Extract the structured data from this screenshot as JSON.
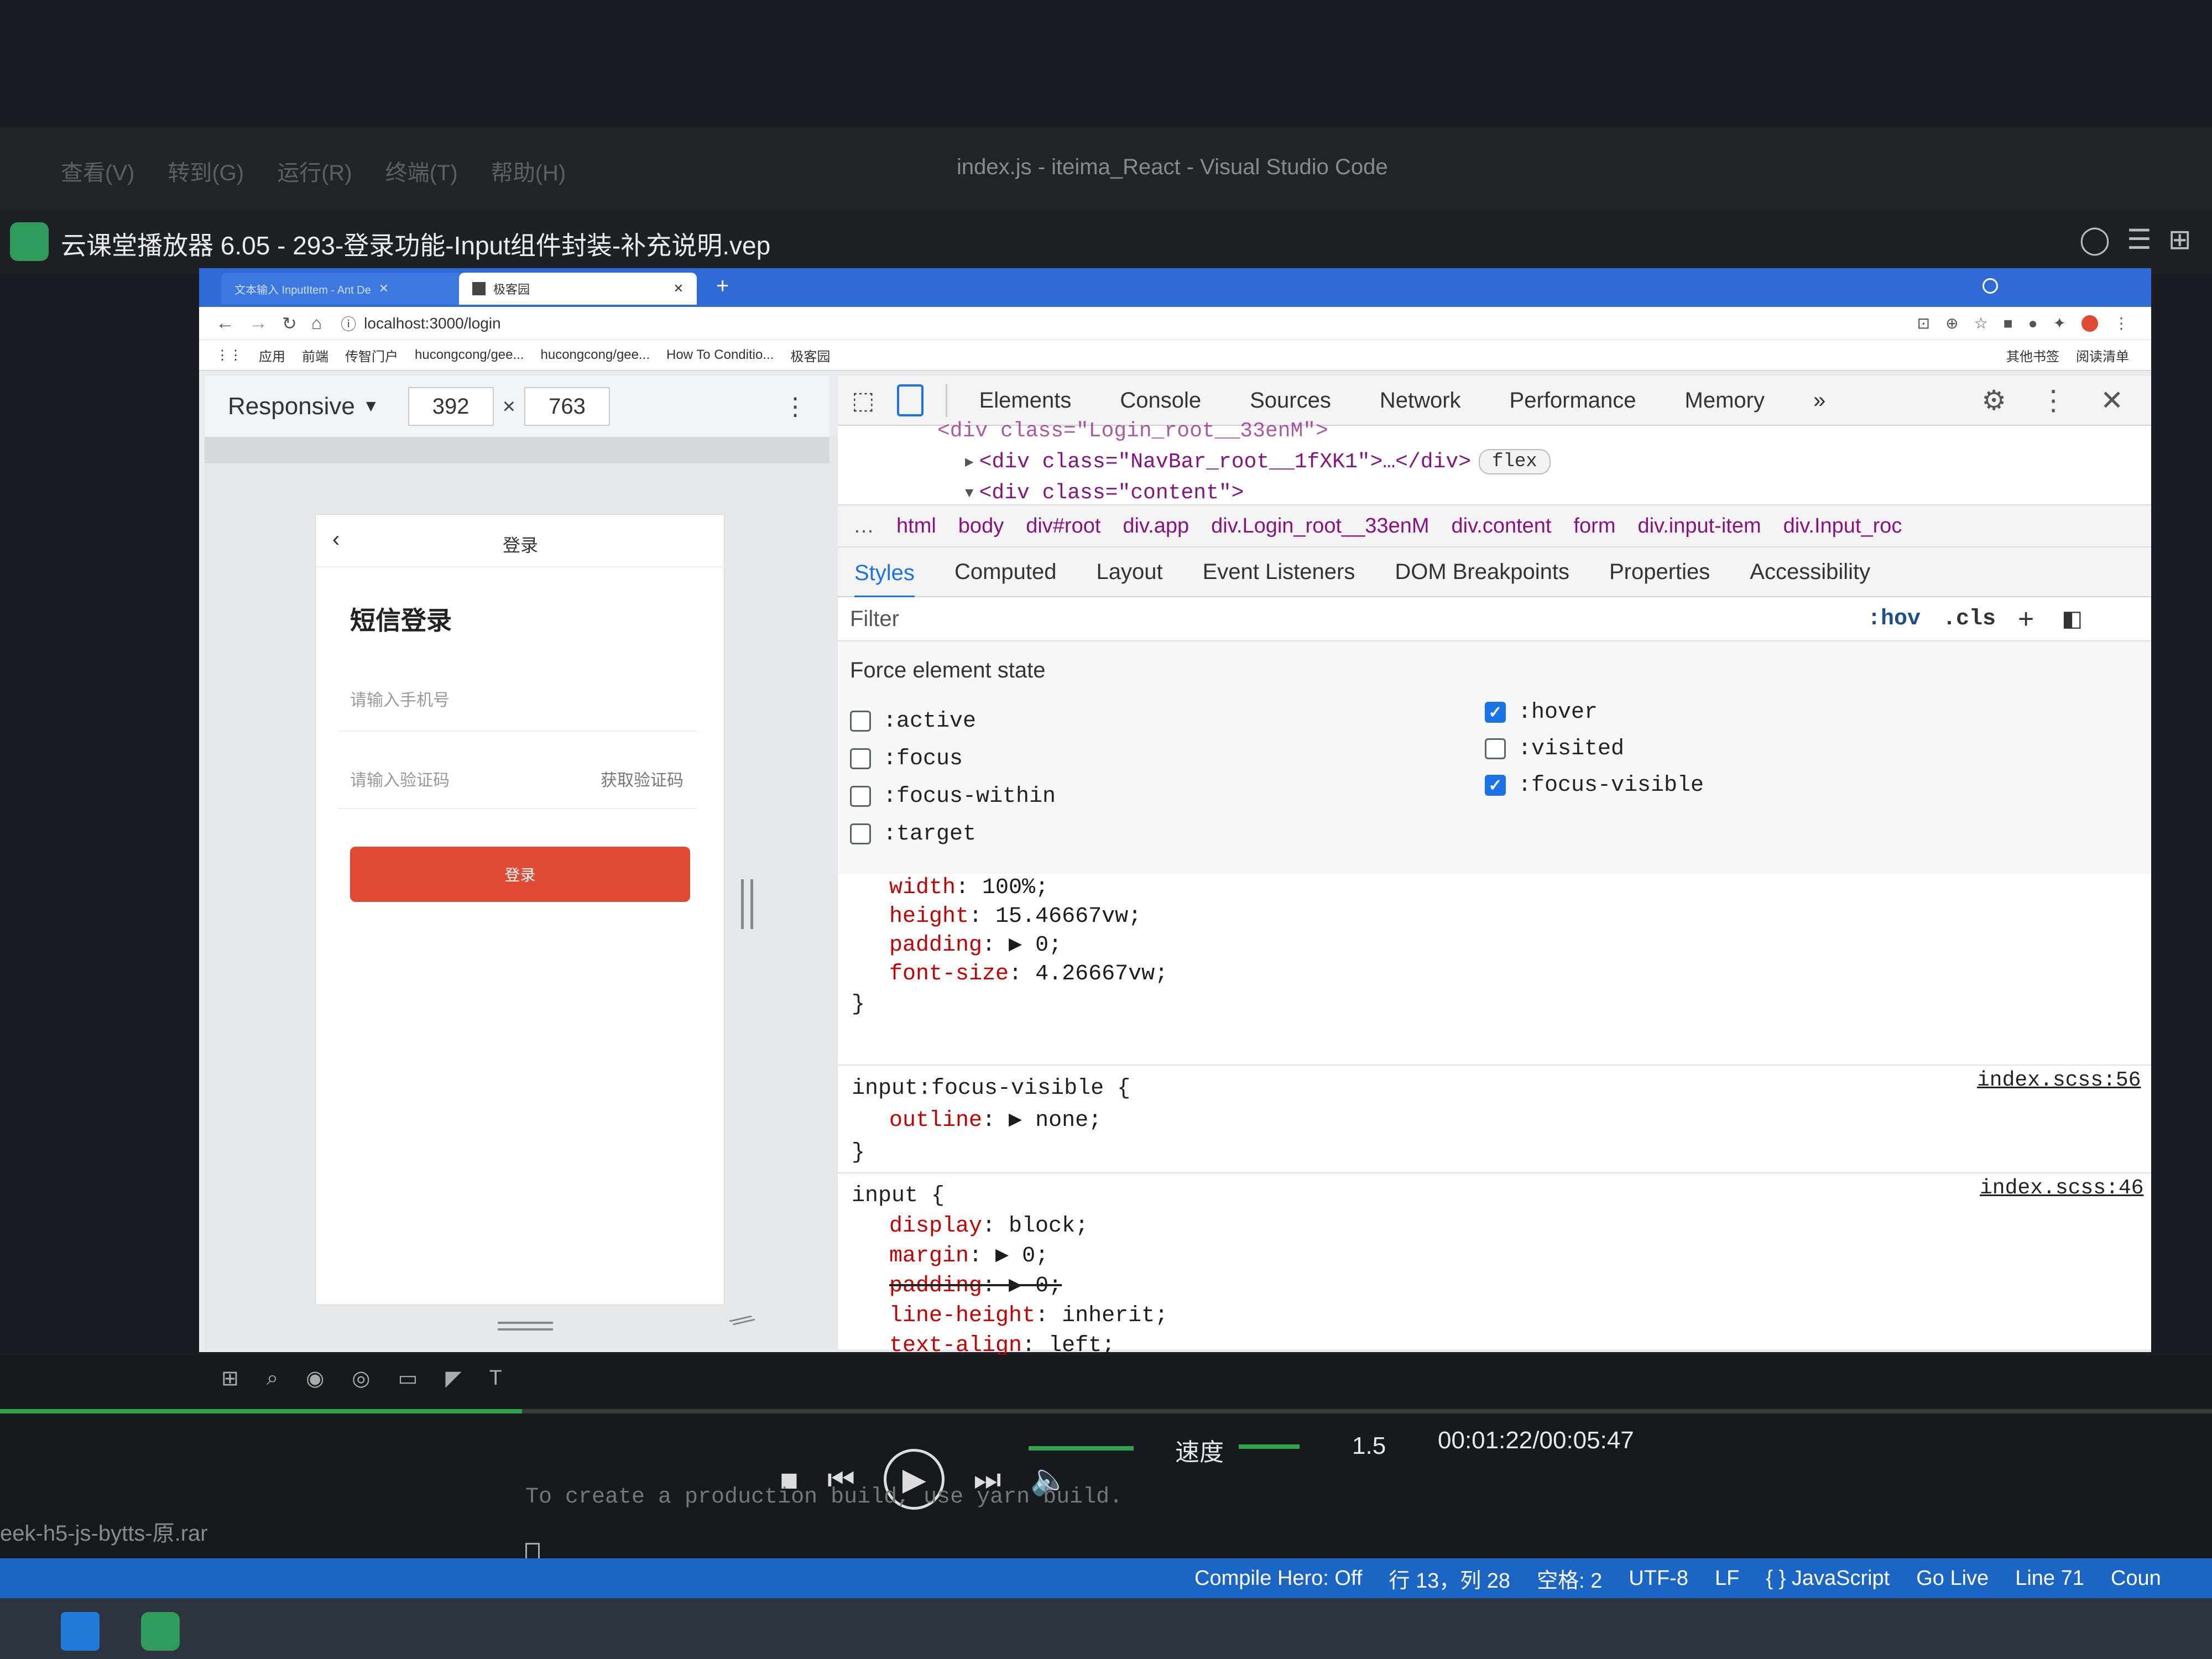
{
  "vscode": {
    "title": "index.js - iteima_React - Visual Studio Code",
    "menu": [
      "查看(V)",
      "转到(G)",
      "运行(R)",
      "终端(T)",
      "帮助(H)"
    ]
  },
  "player": {
    "title": "云课堂播放器 6.05 - 293-登录功能-Input组件封装-补充说明.vep",
    "speed_label": "速度",
    "speed_value": "1.5",
    "time": "00:01:22/00:05:47",
    "progress": 0.236
  },
  "browser": {
    "tabs": [
      {
        "label": "文本输入 InputItem - Ant De",
        "active": false
      },
      {
        "label": "极客园",
        "active": true
      }
    ],
    "url": "localhost:3000/login",
    "bookmarks": [
      "应用",
      "前端",
      "传智门户",
      "hucongcong/gee...",
      "hucongcong/gee...",
      "How To Conditio...",
      "极客园"
    ],
    "bookmarks_right": [
      "其他书签",
      "阅读清单"
    ]
  },
  "device_toolbar": {
    "mode": "Responsive",
    "width": "392",
    "height": "763",
    "times": "×"
  },
  "phone": {
    "nav_title": "登录",
    "heading": "短信登录",
    "phone_placeholder": "请输入手机号",
    "code_placeholder": "请输入验证码",
    "get_code": "获取验证码",
    "login_button": "登录",
    "brand_red": "#e04a35"
  },
  "devtools": {
    "tabs": [
      "Elements",
      "Console",
      "Sources",
      "Network",
      "Performance",
      "Memory"
    ],
    "active_tab": "Elements",
    "dom_lines": [
      "<div class=\"Login_root__33enM\">",
      "<div class=\"NavBar_root__1fXK1\">…</div>",
      "<div class=\"content\">"
    ],
    "dom_badge": "flex",
    "breadcrumb": [
      "…",
      "html",
      "body",
      "div#root",
      "div.app",
      "div.Login_root__33enM",
      "div.content",
      "form",
      "div.input-item",
      "div.Input_roc"
    ],
    "styles_tabs": [
      "Styles",
      "Computed",
      "Layout",
      "Event Listeners",
      "DOM Breakpoints",
      "Properties",
      "Accessibility"
    ],
    "filter_placeholder": "Filter",
    "hov": ":hov",
    "cls": ".cls",
    "force_state_title": "Force element state",
    "states_left": [
      {
        "label": ":active",
        "checked": false
      },
      {
        "label": ":focus",
        "checked": false
      },
      {
        "label": ":focus-within",
        "checked": false
      },
      {
        "label": ":target",
        "checked": false
      }
    ],
    "states_right": [
      {
        "label": ":hover",
        "checked": true
      },
      {
        "label": ":visited",
        "checked": false
      },
      {
        "label": ":focus-visible",
        "checked": true
      }
    ],
    "rule1": [
      {
        "prop": "width",
        "val": "100%;"
      },
      {
        "prop": "height",
        "val": "15.46667vw;"
      },
      {
        "prop": "padding",
        "val": "▶ 0;"
      },
      {
        "prop": "font-size",
        "val": "4.26667vw;"
      }
    ],
    "rule2_selector": "input:focus-visible {",
    "rule2_source": "index.scss:56",
    "rule2": [
      {
        "prop": "outline",
        "val": "▶ none;"
      }
    ],
    "rule3_selector": "input {",
    "rule3_source": "index.scss:46",
    "rule3": [
      {
        "prop": "display",
        "val": "block;"
      },
      {
        "prop": "margin",
        "val": "▶ 0;"
      },
      {
        "prop": "padding",
        "val": "▶ 0;",
        "struck": true
      },
      {
        "prop": "line-height",
        "val": "inherit;"
      },
      {
        "prop": "text-align",
        "val": "left;"
      }
    ],
    "brace_close": "}"
  },
  "terminal": {
    "line": "To create a production build, use yarn build.",
    "left_file": "eek-h5-js-bytts-原.rar"
  },
  "statusbar": {
    "items": [
      "Compile Hero: Off",
      "行 13，列 28",
      "空格: 2",
      "UTF-8",
      "LF",
      "{ } JavaScript",
      "Go Live",
      "Line 71",
      "Coun"
    ]
  }
}
